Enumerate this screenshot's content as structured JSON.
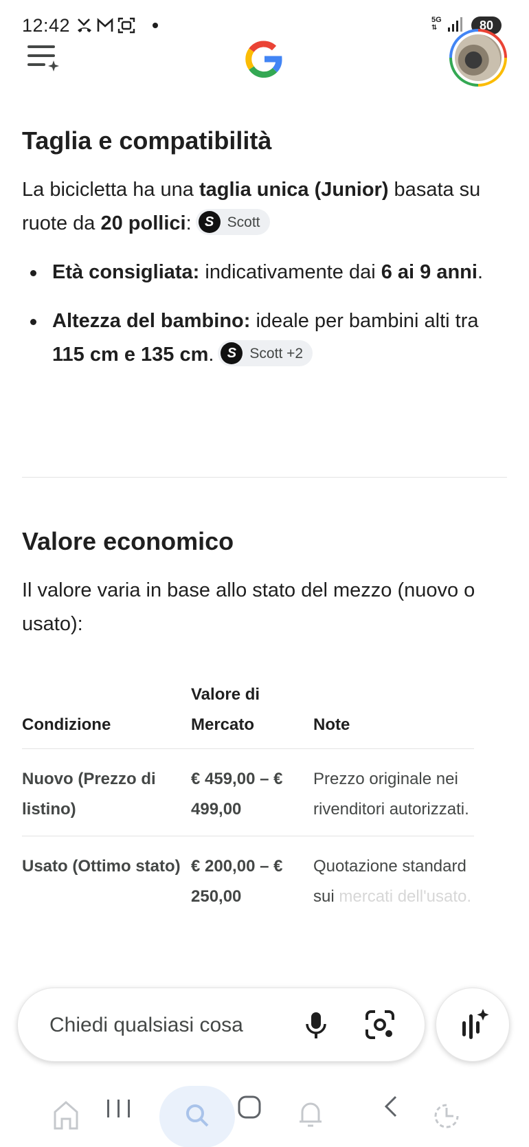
{
  "status_bar": {
    "time": "12:42",
    "network": "5G",
    "battery": "80"
  },
  "header": {
    "menu_icon": "menu-sparkle-icon",
    "logo": "google-g-logo",
    "avatar": "user-avatar"
  },
  "section_size": {
    "title": "Taglia e compatibilità",
    "intro": {
      "t1": "La bicicletta ha una ",
      "b1": "taglia unica (Junior)",
      "t2": " basata su ruote da ",
      "b2": "20 pollici",
      "t3": ":",
      "chip": "Scott"
    },
    "bullets": [
      {
        "label": "Età consigliata:",
        "t1": " indicativamente dai ",
        "b1": "6 ai 9 anni",
        "t2": "."
      },
      {
        "label": "Altezza del bambino:",
        "t1": " ideale per bambini alti tra ",
        "b1": "115 cm e 135 cm",
        "t2": ".",
        "chip": "Scott +2"
      }
    ]
  },
  "section_value": {
    "title": "Valore economico",
    "intro": "Il valore varia in base allo stato del mezzo (nuovo o usato):",
    "table": {
      "headers": [
        "Condizione",
        "Valore di Mercato",
        "Note"
      ],
      "rows": [
        {
          "condition": "Nuovo (Prezzo di listino)",
          "value": "€ 459,00 – € 499,00",
          "note": "Prezzo originale nei rivenditori autorizzati."
        },
        {
          "condition": "Usato (Ottimo stato)",
          "value": "€ 200,00 – € 250,00",
          "note_visible": "Quotazione standard sui",
          "note_faded": "mercati dell'usato."
        }
      ]
    }
  },
  "search_bar": {
    "placeholder": "Chiedi qualsiasi cosa"
  },
  "colors": {
    "google_red": "#ea4335",
    "google_yellow": "#fbbc05",
    "google_green": "#34a853",
    "google_blue": "#4285f4",
    "text_primary": "#1f1f1f",
    "text_secondary": "#444746",
    "chip_bg": "#eef0f3"
  }
}
